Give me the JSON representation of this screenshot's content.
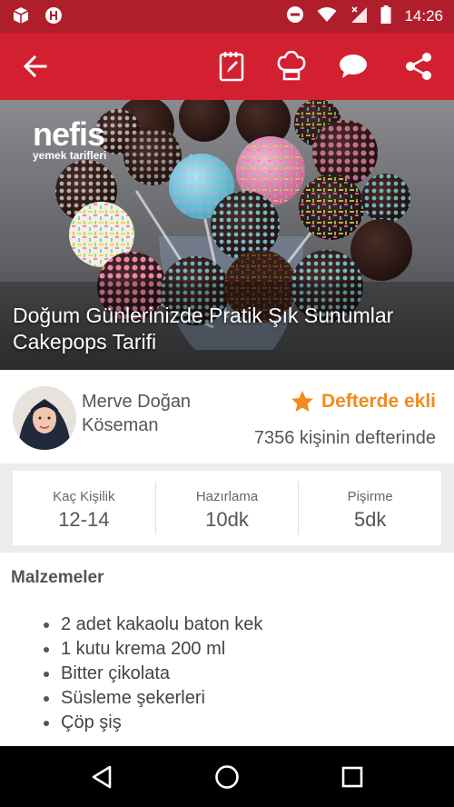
{
  "status_bar": {
    "time": "14:26"
  },
  "toolbar": {
    "back_icon": "arrow-left-icon",
    "actions": [
      "notebook-icon",
      "chef-hat-icon",
      "comment-icon",
      "share-icon"
    ]
  },
  "hero": {
    "logo_main": "nefis",
    "logo_sub": "yemek tarifleri",
    "title": "Doğum Günlerinizde Pratik Şık Sunumlar Cakepops Tarifi"
  },
  "author": {
    "name": "Merve Doğan Köseman"
  },
  "notebook": {
    "label": "Defterde ekli",
    "count_text": "7356 kişinin defterinde"
  },
  "stats": [
    {
      "label": "Kaç Kişilik",
      "value": "12-14"
    },
    {
      "label": "Hazırlama",
      "value": "10dk"
    },
    {
      "label": "Pişirme",
      "value": "5dk"
    }
  ],
  "ingredients": {
    "title": "Malzemeler",
    "items": [
      "2 adet kakaolu baton kek",
      "1 kutu krema 200 ml",
      "Bitter çikolata",
      "Süsleme şekerleri",
      "Çöp şiş"
    ]
  },
  "colors": {
    "status_bar": "#b01e2c",
    "toolbar": "#d32031",
    "accent_orange": "#ef8c1c"
  }
}
